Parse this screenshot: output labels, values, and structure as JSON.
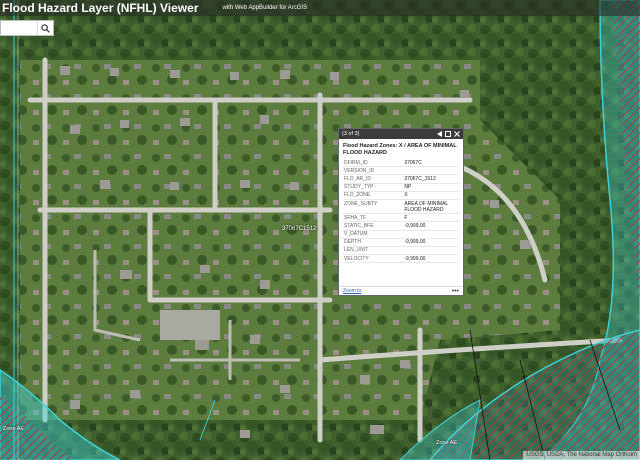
{
  "header": {
    "title": "Flood Hazard Layer (NFHL) Viewer",
    "subtitle": "with Web AppBuilder for ArcGIS"
  },
  "search": {
    "value": "",
    "placeholder": "",
    "icon": "search-icon"
  },
  "popup": {
    "count": "(3 of 3)",
    "title": "Flood Hazard Zones: X / AREA OF MINIMAL FLOOD HAZARD",
    "fields": [
      {
        "key": "DFIRM_ID",
        "value": "37067C"
      },
      {
        "key": "VERSION_ID",
        "value": ""
      },
      {
        "key": "FLD_AR_ID",
        "value": "37067C_1512"
      },
      {
        "key": "STUDY_TYP",
        "value": "NP"
      },
      {
        "key": "FLD_ZONE",
        "value": "X"
      },
      {
        "key": "ZONE_SUBTY",
        "value": "AREA OF MINIMAL FLOOD HAZARD"
      },
      {
        "key": "SFHA_TF",
        "value": "F"
      },
      {
        "key": "STATIC_BFE",
        "value": "-9,999.00"
      },
      {
        "key": "V_DATUM",
        "value": ""
      },
      {
        "key": "DEPTH",
        "value": "-9,999.00"
      },
      {
        "key": "LEN_UNIT",
        "value": ""
      },
      {
        "key": "VELOCITY",
        "value": "-9,999.00"
      }
    ],
    "zoom_label": "Zoom to",
    "more_label": "•••"
  },
  "map": {
    "labels": {
      "point_label": "37067C1512",
      "zone_ae_left": "Zone AE",
      "zone_ae_bottom": "Zone AE"
    },
    "colors": {
      "flood_zone": "#3fd1d6",
      "floodway_hatch": "#c0392b"
    }
  },
  "attribution": "USGS, USDA, The National Map Orthoim"
}
